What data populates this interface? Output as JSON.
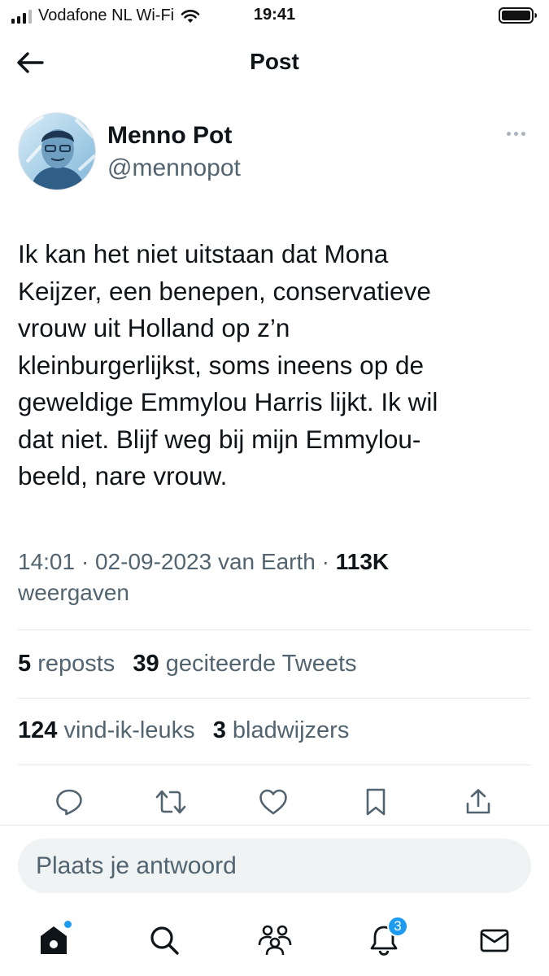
{
  "status_bar": {
    "carrier": "Vodafone NL Wi-Fi",
    "time": "19:41"
  },
  "header": {
    "title": "Post"
  },
  "author": {
    "name": "Menno Pot",
    "handle": "@mennopot"
  },
  "tweet": {
    "lines": [
      "Ik kan het niet uitstaan dat Mona",
      "Keijzer, een benepen, conservatieve",
      "vrouw uit Holland op z’n",
      "kleinburgerlijkst, soms ineens op de",
      "geweldige Emmylou Harris lijkt. Ik wil",
      "dat niet. Blijf weg bij mijn Emmylou-",
      "beeld, nare vrouw."
    ],
    "time": "14:01",
    "date": "02-09-2023",
    "source": "van Earth",
    "views_count": "113K",
    "views_label": "weergaven"
  },
  "stats": {
    "reposts_count": "5",
    "reposts_label": "reposts",
    "quotes_count": "39",
    "quotes_label": "geciteerde Tweets",
    "likes_count": "124",
    "likes_label": "vind-ik-leuks",
    "bookmarks_count": "3",
    "bookmarks_label": "bladwijzers"
  },
  "actions": [
    "reply-icon",
    "retweet-icon",
    "like-icon",
    "bookmark-icon",
    "share-icon"
  ],
  "reply": {
    "placeholder": "Plaats je antwoord"
  },
  "tabbar": {
    "items": [
      "home-icon",
      "search-icon",
      "communities-icon",
      "notifications-icon",
      "messages-icon"
    ],
    "notifications_badge": "3"
  },
  "colors": {
    "accent": "#1d9bf0",
    "text": "#0f1419",
    "secondary": "#536471",
    "divider": "#e7e9ea"
  }
}
